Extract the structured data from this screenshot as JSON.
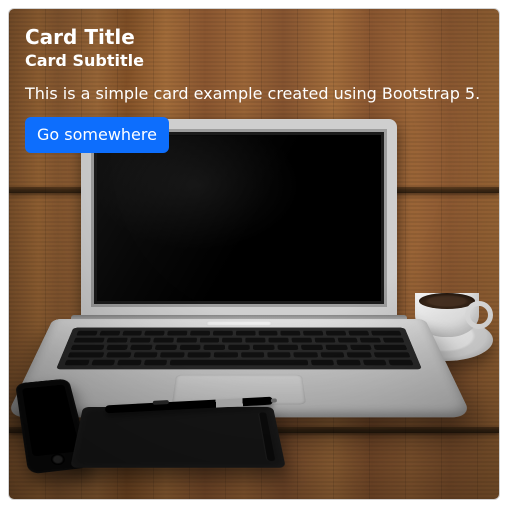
{
  "card": {
    "title": "Card Title",
    "subtitle": "Card Subtitle",
    "text": "This is a simple card example created using Bootstrap 5.",
    "button_label": "Go somewhere"
  }
}
